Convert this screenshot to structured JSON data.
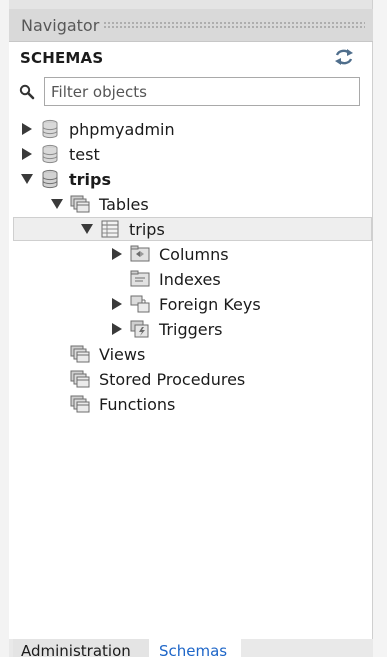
{
  "navigator": {
    "title": "Navigator"
  },
  "schemas_panel": {
    "title": "SCHEMAS",
    "filter_placeholder": "Filter objects"
  },
  "tree": {
    "phpmyadmin": "phpmyadmin",
    "test": "test",
    "trips_schema": "trips",
    "tables": "Tables",
    "trips_table": "trips",
    "columns": "Columns",
    "indexes": "Indexes",
    "foreign_keys": "Foreign Keys",
    "triggers": "Triggers",
    "views": "Views",
    "stored_procedures": "Stored Procedures",
    "functions": "Functions"
  },
  "bottom_tabs": {
    "administration": "Administration",
    "schemas": "Schemas"
  },
  "colors": {
    "accent": "#1e66c8",
    "twisty": "#3a3a3a",
    "panel_bg": "#ffffff"
  }
}
